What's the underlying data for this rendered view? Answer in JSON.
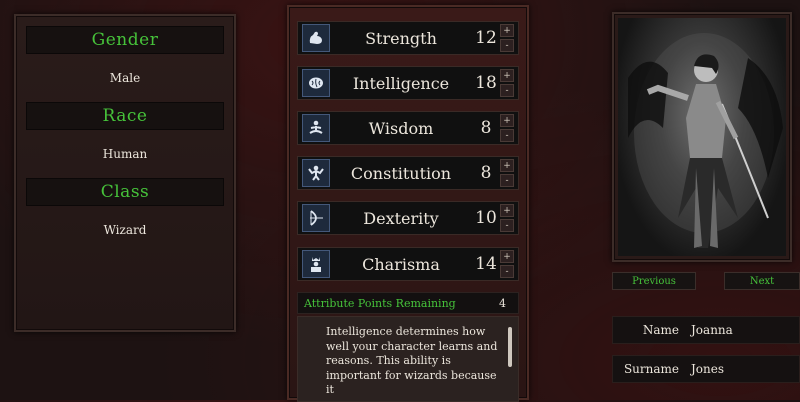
{
  "left": {
    "gender": {
      "heading": "Gender",
      "value": "Male"
    },
    "race": {
      "heading": "Race",
      "value": "Human"
    },
    "class": {
      "heading": "Class",
      "value": "Wizard"
    }
  },
  "attributes": [
    {
      "name": "Strength",
      "value": "12",
      "icon": "flexed-arm-icon"
    },
    {
      "name": "Intelligence",
      "value": "18",
      "icon": "brain-icon"
    },
    {
      "name": "Wisdom",
      "value": "8",
      "icon": "meditation-icon"
    },
    {
      "name": "Constitution",
      "value": "8",
      "icon": "strongman-icon"
    },
    {
      "name": "Dexterity",
      "value": "10",
      "icon": "archer-icon"
    },
    {
      "name": "Charisma",
      "value": "14",
      "icon": "king-icon"
    }
  ],
  "stepper": {
    "plus": "+",
    "minus": "-"
  },
  "points": {
    "label": "Attribute Points Remaining",
    "value": "4"
  },
  "description": "Intelligence determines how well your character learns and reasons. This ability is important for wizards because it",
  "portrait_nav": {
    "previous": "Previous",
    "next": "Next"
  },
  "identity": {
    "name_label": "Name",
    "name_value": "Joanna",
    "surname_label": "Surname",
    "surname_value": "Jones"
  },
  "colors": {
    "accent_green": "#46c23a",
    "background": "#1d1212"
  }
}
